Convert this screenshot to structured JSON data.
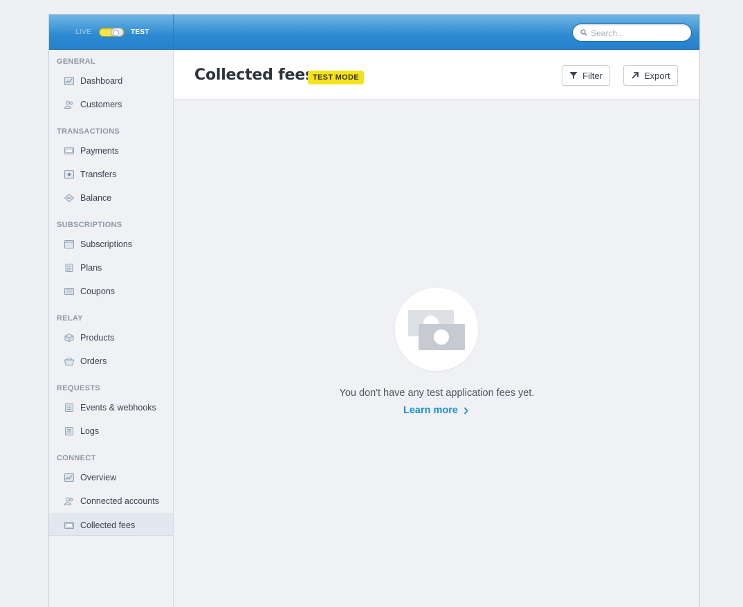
{
  "topbar": {
    "mode_live": "LIVE",
    "mode_test": "TEST",
    "search_placeholder": "Search..."
  },
  "sidebar": {
    "sections": [
      {
        "title": "GENERAL",
        "items": [
          {
            "label": "Dashboard",
            "icon": "dashboard-icon"
          },
          {
            "label": "Customers",
            "icon": "customers-icon"
          }
        ]
      },
      {
        "title": "TRANSACTIONS",
        "items": [
          {
            "label": "Payments",
            "icon": "payments-icon"
          },
          {
            "label": "Transfers",
            "icon": "transfers-icon"
          },
          {
            "label": "Balance",
            "icon": "balance-icon"
          }
        ]
      },
      {
        "title": "SUBSCRIPTIONS",
        "items": [
          {
            "label": "Subscriptions",
            "icon": "subscriptions-icon"
          },
          {
            "label": "Plans",
            "icon": "plans-icon"
          },
          {
            "label": "Coupons",
            "icon": "coupons-icon"
          }
        ]
      },
      {
        "title": "RELAY",
        "items": [
          {
            "label": "Products",
            "icon": "products-icon"
          },
          {
            "label": "Orders",
            "icon": "orders-icon"
          }
        ]
      },
      {
        "title": "REQUESTS",
        "items": [
          {
            "label": "Events & webhooks",
            "icon": "events-icon"
          },
          {
            "label": "Logs",
            "icon": "logs-icon"
          }
        ]
      },
      {
        "title": "CONNECT",
        "items": [
          {
            "label": "Overview",
            "icon": "overview-icon"
          },
          {
            "label": "Connected accounts",
            "icon": "connected-accounts-icon"
          },
          {
            "label": "Collected fees",
            "icon": "collected-fees-icon",
            "active": true
          }
        ]
      }
    ]
  },
  "header": {
    "title": "Collected fees",
    "badge": "TEST MODE",
    "filter_label": "Filter",
    "export_label": "Export"
  },
  "empty_state": {
    "message": "You don't have any test application fees yet.",
    "link": "Learn more"
  },
  "colors": {
    "topbar": "#2d8ad1",
    "badge": "#f5e21e",
    "link": "#1a8ed4"
  }
}
